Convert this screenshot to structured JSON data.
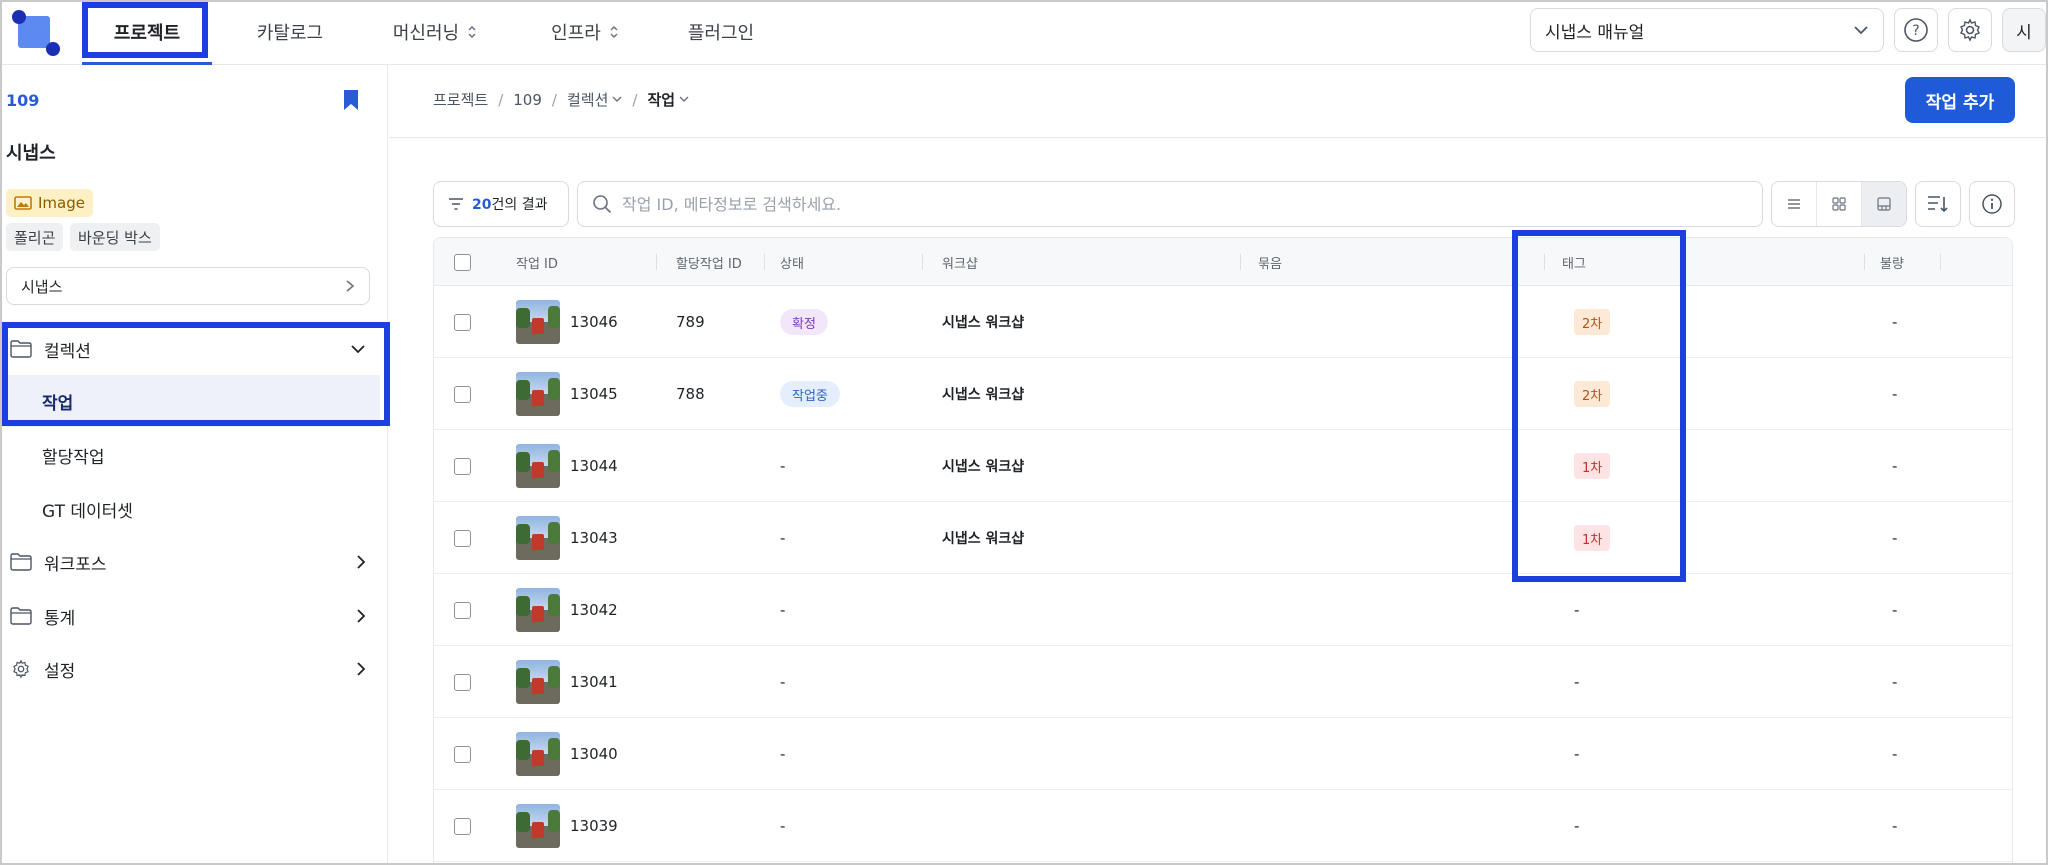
{
  "nav": {
    "tabs": [
      {
        "label": "프로젝트"
      },
      {
        "label": "카탈로그"
      },
      {
        "label": "머신러닝"
      },
      {
        "label": "인프라"
      },
      {
        "label": "플러그인"
      }
    ],
    "manual_label": "시냅스 매뉴얼",
    "avatar": "시"
  },
  "sidebar": {
    "project_id": "109",
    "project_name": "시냅스",
    "type_chip": "Image",
    "chips": [
      "폴리곤",
      "바운딩 박스"
    ],
    "select_label": "시냅스",
    "menu": {
      "collection": "컬렉션",
      "sub": [
        "작업",
        "할당작업",
        "GT 데이터셋"
      ],
      "workforce": "워크포스",
      "stats": "통계",
      "settings": "설정"
    }
  },
  "main": {
    "breadcrumb": [
      "프로젝트",
      "109",
      "컬렉션",
      "작업"
    ],
    "add_button": "작업 추가",
    "result_count": "20",
    "result_suffix": "건의 결과",
    "search_placeholder": "작업 ID, 메타정보로 검색하세요.",
    "columns": [
      "작업 ID",
      "할당작업 ID",
      "상태",
      "워크샵",
      "묶음",
      "태그",
      "불량"
    ],
    "rows": [
      {
        "id": "13046",
        "assign": "789",
        "status": "확정",
        "status_type": "confirm",
        "workshop": "시냅스 워크샵",
        "tag": "2차",
        "tag_type": "second",
        "defect": "-"
      },
      {
        "id": "13045",
        "assign": "788",
        "status": "작업중",
        "status_type": "working",
        "workshop": "시냅스 워크샵",
        "tag": "2차",
        "tag_type": "second",
        "defect": "-"
      },
      {
        "id": "13044",
        "assign": "",
        "status": "-",
        "status_type": "none",
        "workshop": "시냅스 워크샵",
        "tag": "1차",
        "tag_type": "first",
        "defect": "-"
      },
      {
        "id": "13043",
        "assign": "",
        "status": "-",
        "status_type": "none",
        "workshop": "시냅스 워크샵",
        "tag": "1차",
        "tag_type": "first",
        "defect": "-"
      },
      {
        "id": "13042",
        "assign": "",
        "status": "-",
        "status_type": "none",
        "workshop": "",
        "tag": "-",
        "tag_type": "none",
        "defect": "-"
      },
      {
        "id": "13041",
        "assign": "",
        "status": "-",
        "status_type": "none",
        "workshop": "",
        "tag": "-",
        "tag_type": "none",
        "defect": "-"
      },
      {
        "id": "13040",
        "assign": "",
        "status": "-",
        "status_type": "none",
        "workshop": "",
        "tag": "-",
        "tag_type": "none",
        "defect": "-"
      },
      {
        "id": "13039",
        "assign": "",
        "status": "-",
        "status_type": "none",
        "workshop": "",
        "tag": "-",
        "tag_type": "none",
        "defect": "-"
      }
    ]
  },
  "colors": {
    "accent": "#1f5bd9",
    "highlight": "#1d3fe0"
  },
  "icons": [
    "logo-icon",
    "chevron-down-icon",
    "help-icon",
    "gear-icon",
    "bookmark-icon",
    "image-icon",
    "chevron-right-icon",
    "folder-icon",
    "filter-icon",
    "search-icon",
    "list-view-icon",
    "grid-view-icon",
    "split-view-icon",
    "sort-icon",
    "info-icon"
  ]
}
